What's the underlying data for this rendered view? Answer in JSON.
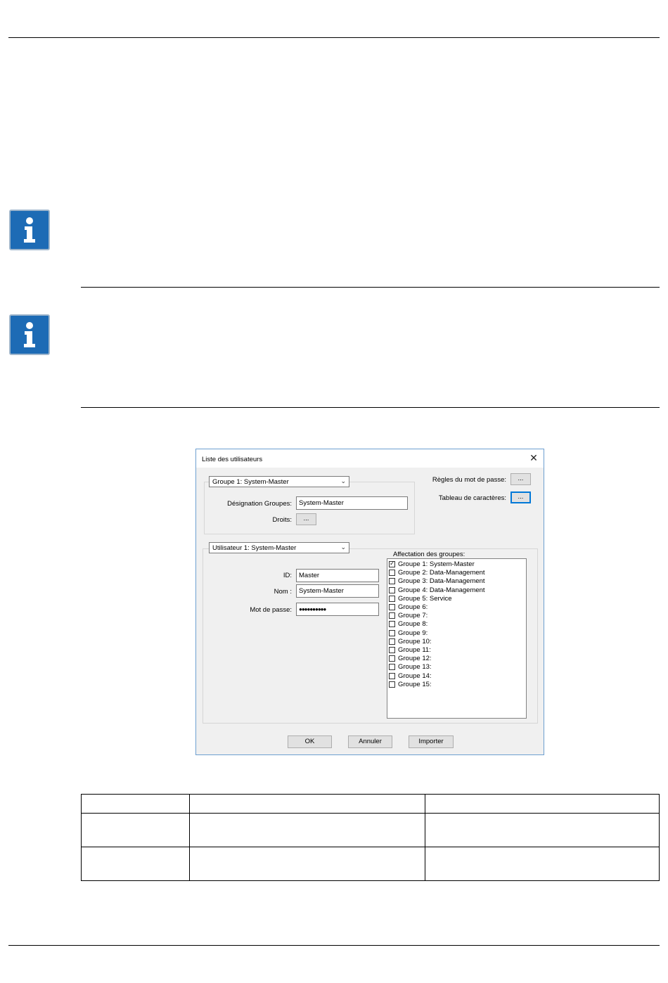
{
  "dialog": {
    "title": "Liste des utilisateurs",
    "group_combo": "Groupe 1: System-Master",
    "designation_label": "Désignation Groupes:",
    "designation_value": "System-Master",
    "rights_label": "Droits:",
    "password_rules_label": "Règles du mot de passe:",
    "char_table_label": "Tableau de caractères:",
    "ellipsis": "...",
    "user_combo": "Utilisateur 1: System-Master",
    "id_label": "ID:",
    "id_value": "Master",
    "name_label": "Nom :",
    "name_value": "System-Master",
    "password_label": "Mot de passe:",
    "password_value": "●●●●●●●●●●",
    "groups_label": "Affectation des groupes:",
    "groups": [
      {
        "label": "Groupe 1: System-Master",
        "checked": true
      },
      {
        "label": "Groupe 2: Data-Management",
        "checked": false
      },
      {
        "label": "Groupe 3: Data-Management",
        "checked": false
      },
      {
        "label": "Groupe 4: Data-Management",
        "checked": false
      },
      {
        "label": "Groupe 5: Service",
        "checked": false
      },
      {
        "label": "Groupe 6:",
        "checked": false
      },
      {
        "label": "Groupe 7:",
        "checked": false
      },
      {
        "label": "Groupe 8:",
        "checked": false
      },
      {
        "label": "Groupe 9:",
        "checked": false
      },
      {
        "label": "Groupe 10:",
        "checked": false
      },
      {
        "label": "Groupe 11:",
        "checked": false
      },
      {
        "label": "Groupe 12:",
        "checked": false
      },
      {
        "label": "Groupe 13:",
        "checked": false
      },
      {
        "label": "Groupe 14:",
        "checked": false
      },
      {
        "label": "Groupe 15:",
        "checked": false
      }
    ],
    "ok_label": "OK",
    "cancel_label": "Annuler",
    "import_label": "Importer"
  },
  "colors": {
    "info_icon": "#1d6bb5",
    "dialog_bg": "#f0f0f0",
    "focus_border": "#0078d7"
  }
}
